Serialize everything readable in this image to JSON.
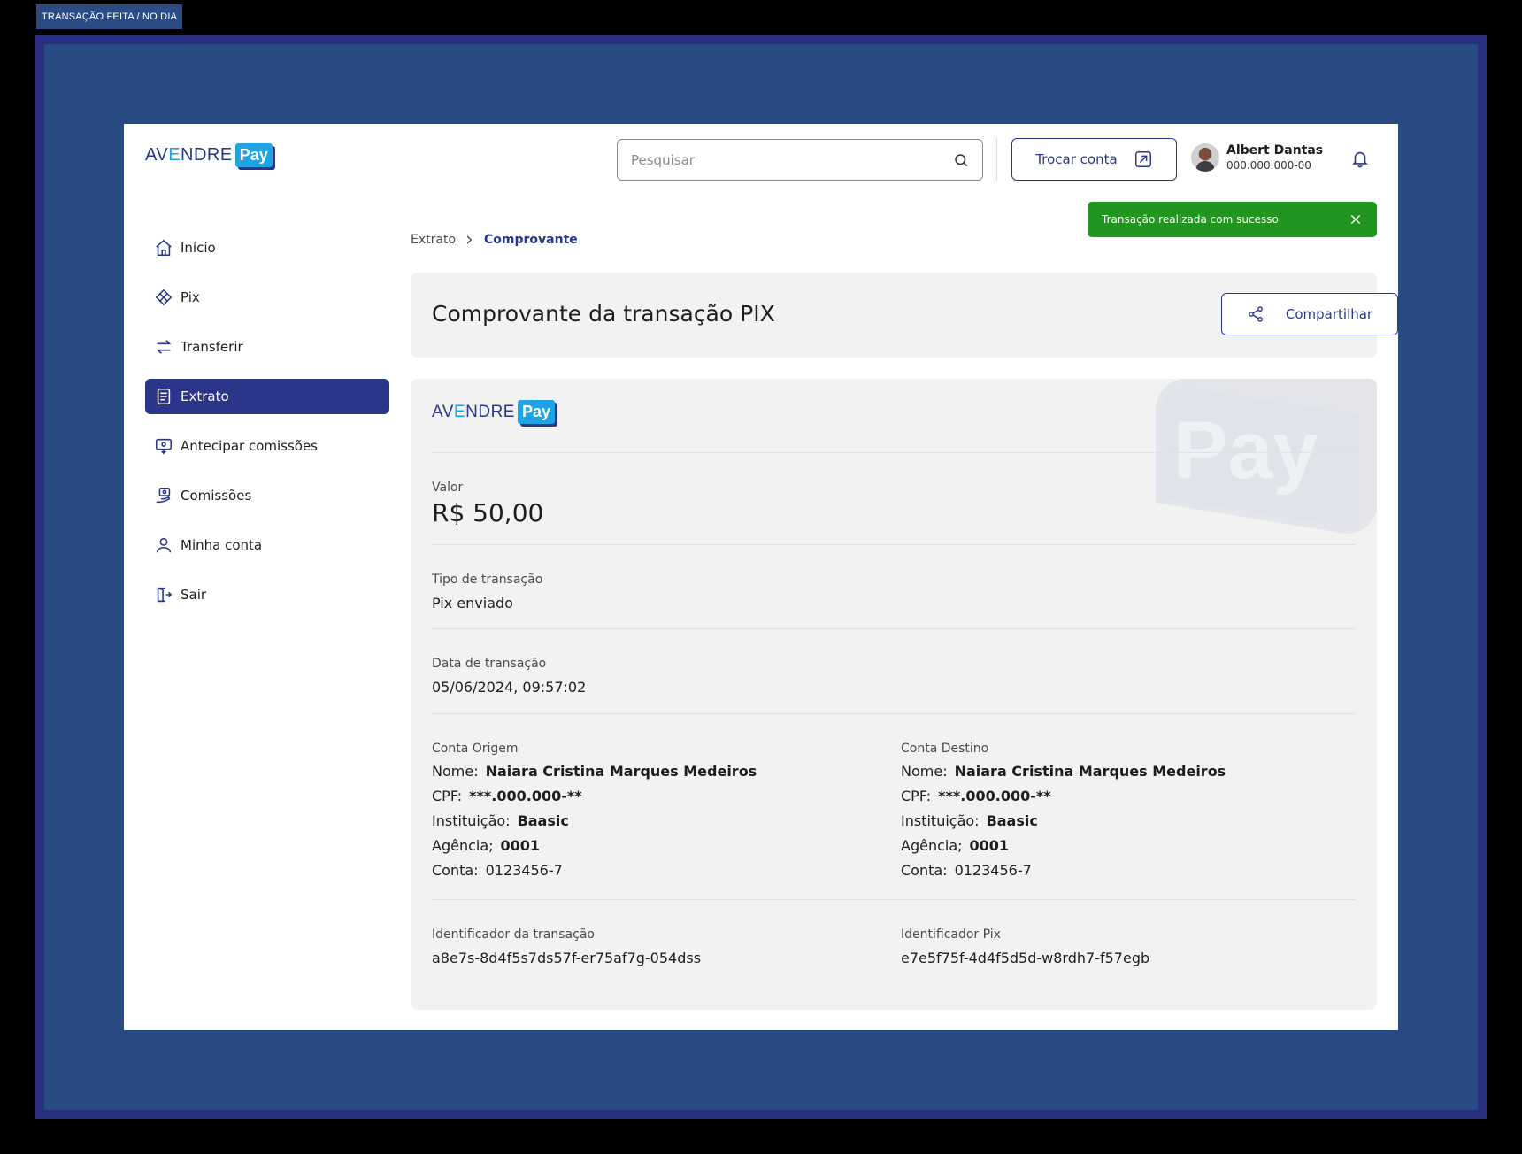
{
  "frame_label": "TRANSAÇÃO FEITA / NO DIA",
  "brand": {
    "word_start": "AV",
    "word_accent": "E",
    "word_end": "NDRE",
    "pay": "Pay",
    "accent": "#1fa3e2",
    "primary": "#2b3589"
  },
  "header": {
    "search_placeholder": "Pesquisar",
    "switch_account": "Trocar conta",
    "user_name": "Albert Dantas",
    "user_doc": "000.000.000-00"
  },
  "sidebar": {
    "items": [
      {
        "label": "Início",
        "icon": "home-icon"
      },
      {
        "label": "Pix",
        "icon": "pix-icon"
      },
      {
        "label": "Transferir",
        "icon": "transfer-icon"
      },
      {
        "label": "Extrato",
        "icon": "statement-icon",
        "active": true
      },
      {
        "label": "Antecipar comissões",
        "icon": "anticipate-icon"
      },
      {
        "label": "Comissões",
        "icon": "commissions-icon"
      },
      {
        "label": "Minha conta",
        "icon": "user-icon"
      },
      {
        "label": "Sair",
        "icon": "logout-icon"
      }
    ]
  },
  "breadcrumb": {
    "parent": "Extrato",
    "current": "Comprovante"
  },
  "toast": {
    "message": "Transação realizada com sucesso",
    "color": "#21951f"
  },
  "receipt": {
    "title": "Comprovante da transação PIX",
    "share": "Compartilhar",
    "value_label": "Valor",
    "value": "R$ 50,00",
    "type_label": "Tipo de transação",
    "type": "Pix enviado",
    "date_label": "Data de transação",
    "date": "05/06/2024, 09:57:02",
    "origin": {
      "title": "Conta Origem",
      "name_label": "Nome:",
      "name": "Naiara Cristina Marques Medeiros",
      "cpf_label": "CPF:",
      "cpf": "***.000.000-**",
      "inst_label": "Instituição:",
      "inst": "Baasic",
      "agency_label": "Agência;",
      "agency": "0001",
      "account_label": "Conta:",
      "account": "0123456-7"
    },
    "destination": {
      "title": "Conta Destino",
      "name_label": "Nome:",
      "name": "Naiara Cristina Marques Medeiros",
      "cpf_label": "CPF:",
      "cpf": "***.000.000-**",
      "inst_label": "Instituição:",
      "inst": "Baasic",
      "agency_label": "Agência;",
      "agency": "0001",
      "account_label": "Conta:",
      "account": "0123456-7"
    },
    "tx_id_label": "Identificador da transação",
    "tx_id": "a8e7s-8d4f5s7ds57f-er75af7g-054dss",
    "pix_id_label": "Identificador Pix",
    "pix_id": "e7e5f75f-4d4f5d5d-w8rdh7-f57egb"
  }
}
